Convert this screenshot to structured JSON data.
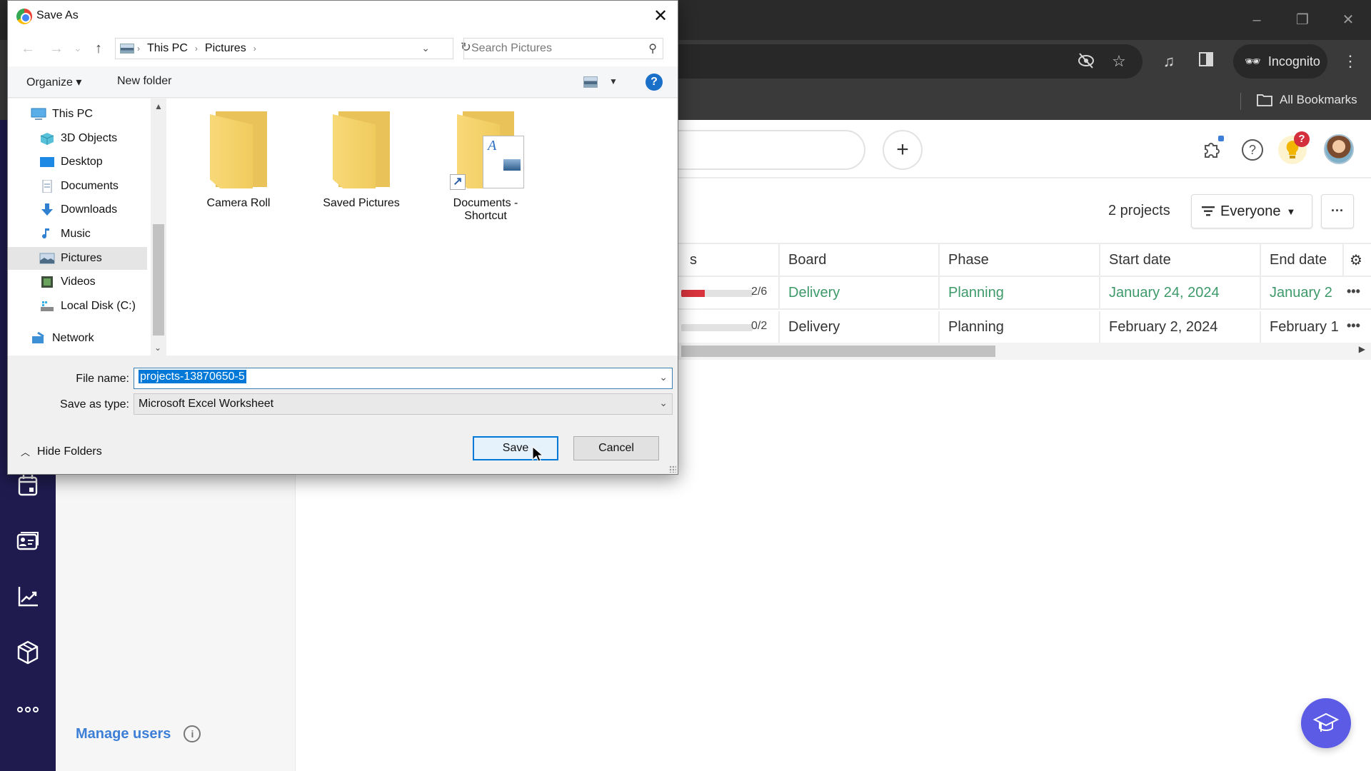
{
  "browser": {
    "window_controls": {
      "minimize": "–",
      "restore": "❐",
      "close": "✕"
    },
    "toolbar": {
      "eye_slash_icon": "eye-slash",
      "star_icon": "star",
      "media_icon": "media",
      "side_panel_icon": "side-panel",
      "incognito_label": "Incognito",
      "menu_icon": "⋮"
    },
    "bookmarks": {
      "all_bookmarks_label": "All Bookmarks"
    }
  },
  "app": {
    "rail_icons": [
      "calendar",
      "contacts-card",
      "chart-line",
      "package-box",
      "more"
    ],
    "manage_users_label": "Manage users",
    "header": {
      "plus_label": "+",
      "help_label": "?",
      "notif_badge": "?"
    },
    "projects_count": "2 projects",
    "filter": {
      "label": "Everyone",
      "icon": "filter"
    },
    "more_label": "···",
    "table": {
      "columns": [
        "s",
        "Board",
        "Phase",
        "Start date",
        "End date"
      ],
      "rows": [
        {
          "progress_label": "2/6",
          "progress": 0.333,
          "board": "Delivery",
          "phase": "Planning",
          "start": "January 24, 2024",
          "end": "January 2",
          "highlight": true,
          "more": "•••"
        },
        {
          "progress_label": "0/2",
          "progress": 0,
          "board": "Delivery",
          "phase": "Planning",
          "start": "February 2, 2024",
          "end": "February 1",
          "highlight": false,
          "more": "•••"
        }
      ]
    },
    "fab_icon": "graduation-cap"
  },
  "dialog": {
    "title": "Save As",
    "close_label": "✕",
    "nav": {
      "back": "←",
      "forward": "→",
      "recent": "⌄",
      "up": "↑"
    },
    "breadcrumb": [
      "This PC",
      "Pictures"
    ],
    "search_placeholder": "Search Pictures",
    "commands": {
      "organize": "Organize ▾",
      "new_folder": "New folder",
      "help": "?"
    },
    "tree": [
      {
        "label": "This PC",
        "icon": "monitor",
        "level": 0,
        "selected": false
      },
      {
        "label": "3D Objects",
        "icon": "cube",
        "level": 1,
        "selected": false
      },
      {
        "label": "Desktop",
        "icon": "desktop",
        "level": 1,
        "selected": false
      },
      {
        "label": "Documents",
        "icon": "document",
        "level": 1,
        "selected": false
      },
      {
        "label": "Downloads",
        "icon": "download",
        "level": 1,
        "selected": false
      },
      {
        "label": "Music",
        "icon": "music-note",
        "level": 1,
        "selected": false
      },
      {
        "label": "Pictures",
        "icon": "picture",
        "level": 1,
        "selected": true
      },
      {
        "label": "Videos",
        "icon": "film",
        "level": 1,
        "selected": false
      },
      {
        "label": "Local Disk (C:)",
        "icon": "drive",
        "level": 1,
        "selected": false
      },
      {
        "label": "Network",
        "icon": "network",
        "level": 0,
        "selected": false
      }
    ],
    "files": [
      {
        "name": "Camera Roll",
        "type": "folder"
      },
      {
        "name": "Saved Pictures",
        "type": "folder"
      },
      {
        "name": "Documents - Shortcut",
        "type": "shortcut"
      }
    ],
    "form": {
      "file_name_label": "File name:",
      "file_name_value": "projects-13870650-5",
      "save_type_label": "Save as type:",
      "save_type_value": "Microsoft Excel Worksheet"
    },
    "hide_folders_label": "Hide Folders",
    "save_label": "Save",
    "cancel_label": "Cancel"
  }
}
